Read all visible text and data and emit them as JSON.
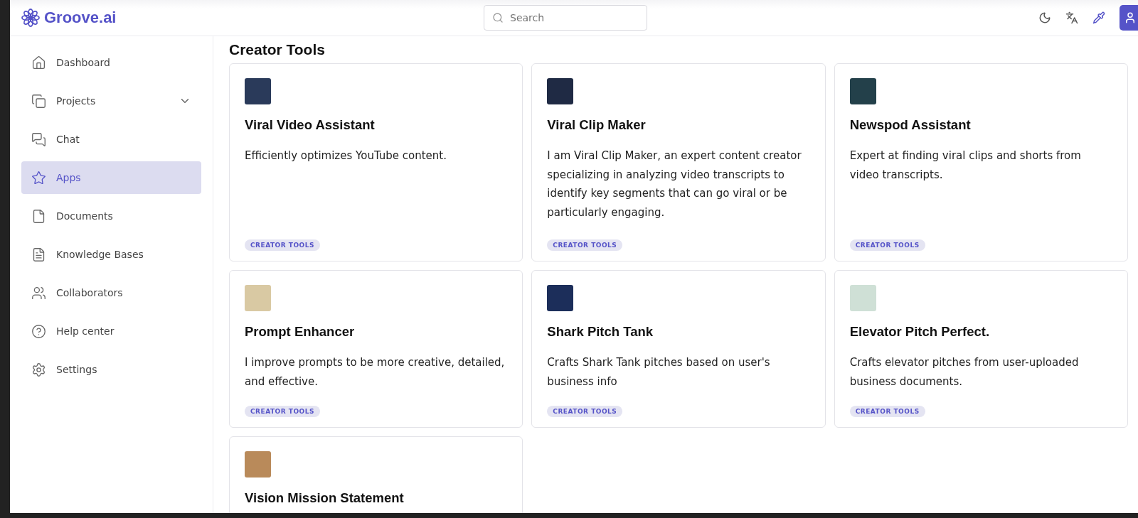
{
  "brand": {
    "name": "Groove.ai"
  },
  "search": {
    "placeholder": "Search"
  },
  "sidebar": {
    "items": [
      {
        "label": "Dashboard",
        "selected": false
      },
      {
        "label": "Projects",
        "selected": false,
        "expandable": true
      },
      {
        "label": "Chat",
        "selected": false
      },
      {
        "label": "Apps",
        "selected": true
      },
      {
        "label": "Documents",
        "selected": false
      },
      {
        "label": "Knowledge Bases",
        "selected": false
      },
      {
        "label": "Collaborators",
        "selected": false
      },
      {
        "label": "Help center",
        "selected": false
      },
      {
        "label": "Settings",
        "selected": false
      }
    ]
  },
  "section": {
    "title": "Creator Tools"
  },
  "apps": [
    {
      "name": "Viral Video Assistant",
      "description": "Efficiently optimizes YouTube content.",
      "tag": "CREATOR TOOLS",
      "color": "#2a3a5a"
    },
    {
      "name": "Viral Clip Maker",
      "description": "I am Viral Clip Maker, an expert content creator specializing in analyzing video transcripts to identify key segments that can go viral or be particularly engaging.",
      "tag": "CREATOR TOOLS",
      "color": "#1f2a44"
    },
    {
      "name": "Newspod Assistant",
      "description": "Expert at finding viral clips and shorts from video transcripts.",
      "tag": "CREATOR TOOLS",
      "color": "#23404a"
    },
    {
      "name": "Prompt Enhancer",
      "description": "I improve prompts to be more creative, detailed, and effective.",
      "tag": "CREATOR TOOLS",
      "color": "#d9c9a3"
    },
    {
      "name": "Shark Pitch Tank",
      "description": "Crafts Shark Tank pitches based on user's business info",
      "tag": "CREATOR TOOLS",
      "color": "#1c2e5a"
    },
    {
      "name": "Elevator Pitch Perfect.",
      "description": "Crafts elevator pitches from user-uploaded business documents.",
      "tag": "CREATOR TOOLS",
      "color": "#cfe0d6"
    },
    {
      "name": "Vision Mission Statement",
      "color": "#b98a5a"
    }
  ]
}
